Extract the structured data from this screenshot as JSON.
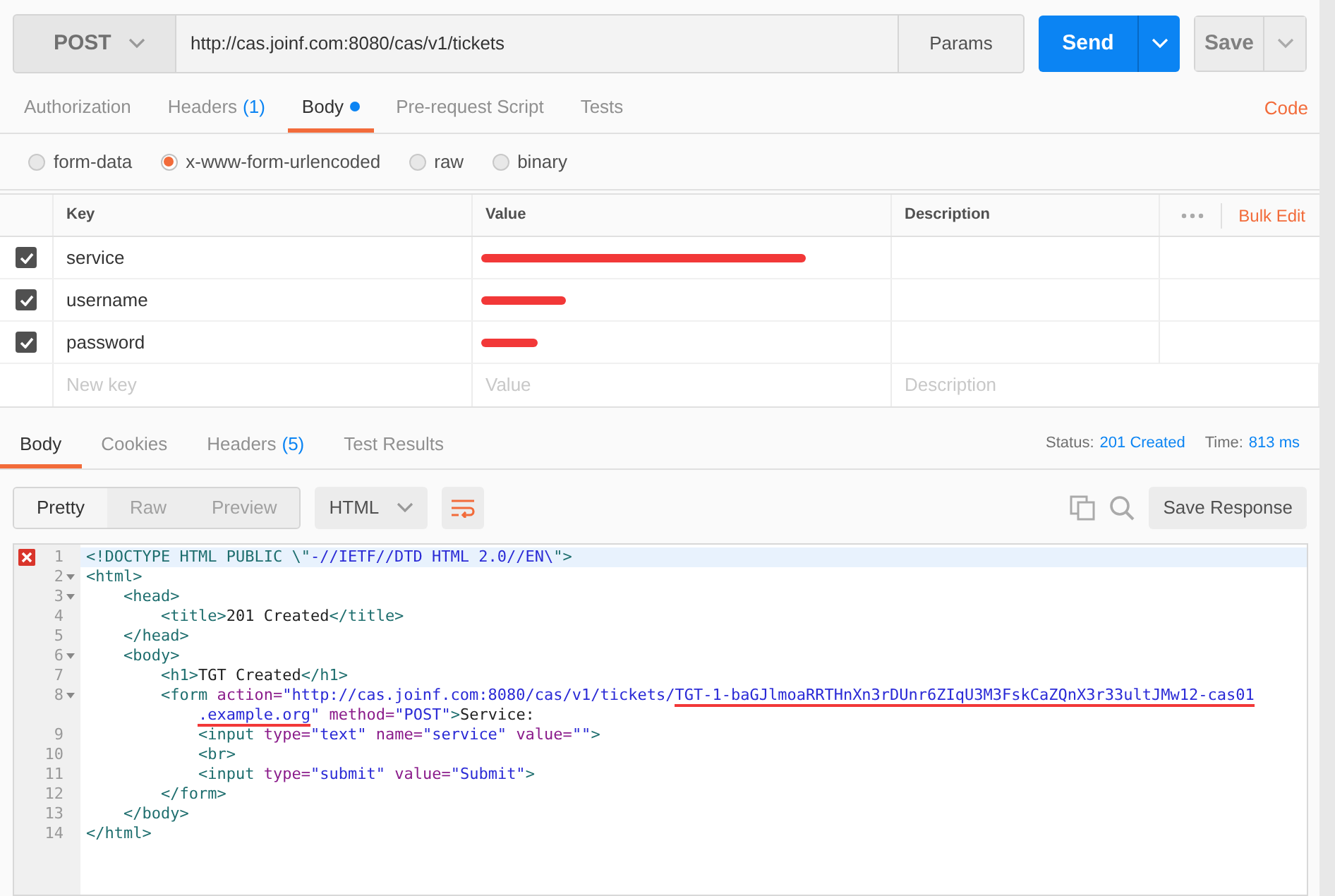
{
  "request": {
    "method": "POST",
    "url": "http://cas.joinf.com:8080/cas/v1/tickets",
    "params_label": "Params",
    "send_label": "Send",
    "save_label": "Save"
  },
  "request_tabs": [
    {
      "label": "Authorization",
      "selected": false
    },
    {
      "label": "Headers",
      "count": "(1)",
      "selected": false
    },
    {
      "label": "Body",
      "selected": true,
      "dot": true
    },
    {
      "label": "Pre-request Script",
      "selected": false
    },
    {
      "label": "Tests",
      "selected": false
    }
  ],
  "code_link": "Code",
  "body_types": [
    {
      "label": "form-data",
      "selected": false
    },
    {
      "label": "x-www-form-urlencoded",
      "selected": true
    },
    {
      "label": "raw",
      "selected": false
    },
    {
      "label": "binary",
      "selected": false
    }
  ],
  "params_table": {
    "columns": [
      "Key",
      "Value",
      "Description"
    ],
    "bulk_edit": "Bulk Edit",
    "rows": [
      {
        "key": "service",
        "checked": true,
        "value_redacted": true
      },
      {
        "key": "username",
        "checked": true,
        "value_redacted": true
      },
      {
        "key": "password",
        "checked": true,
        "value_redacted": true
      }
    ],
    "new_row": {
      "key_placeholder": "New key",
      "value_placeholder": "Value",
      "description_placeholder": "Description"
    }
  },
  "response_tabs": [
    {
      "label": "Body",
      "selected": true
    },
    {
      "label": "Cookies",
      "selected": false
    },
    {
      "label": "Headers",
      "count": "(5)",
      "selected": false
    },
    {
      "label": "Test Results",
      "selected": false
    }
  ],
  "status": {
    "label": "Status:",
    "value": "201 Created"
  },
  "time": {
    "label": "Time:",
    "value": "813 ms"
  },
  "view_modes": [
    {
      "label": "Pretty",
      "selected": true
    },
    {
      "label": "Raw",
      "selected": false
    },
    {
      "label": "Preview",
      "selected": false
    }
  ],
  "format": "HTML",
  "save_response": "Save Response",
  "code_lines": [
    {
      "number": "1",
      "error": true,
      "fold": false,
      "highlighted": true,
      "tokens": [
        {
          "kind": "tag",
          "text": "<!DOCTYPE HTML PUBLIC \\\""
        },
        {
          "kind": "string",
          "text": "-//IETF//DTD HTML 2.0//EN\\"
        },
        {
          "kind": "tag",
          "text": "\">"
        }
      ]
    },
    {
      "number": "2",
      "error": false,
      "fold": true,
      "tokens": [
        {
          "kind": "tag",
          "text": "<html>"
        }
      ]
    },
    {
      "number": "3",
      "error": false,
      "fold": true,
      "tokens": [
        {
          "kind": "tag",
          "text": "    <head>"
        }
      ]
    },
    {
      "number": "4",
      "error": false,
      "fold": false,
      "tokens": [
        {
          "kind": "tag",
          "text": "        <title>"
        },
        {
          "kind": "text",
          "text": "201 Created"
        },
        {
          "kind": "tag",
          "text": "</title>"
        }
      ]
    },
    {
      "number": "5",
      "error": false,
      "fold": false,
      "tokens": [
        {
          "kind": "tag",
          "text": "    </head>"
        }
      ]
    },
    {
      "number": "6",
      "error": false,
      "fold": true,
      "tokens": [
        {
          "kind": "tag",
          "text": "    <body>"
        }
      ]
    },
    {
      "number": "7",
      "error": false,
      "fold": false,
      "tokens": [
        {
          "kind": "tag",
          "text": "        <h1>"
        },
        {
          "kind": "text",
          "text": "TGT Created"
        },
        {
          "kind": "tag",
          "text": "</h1>"
        }
      ]
    },
    {
      "number": "8",
      "error": false,
      "fold": true,
      "tokens": [
        {
          "kind": "tag",
          "text": "        <form "
        },
        {
          "kind": "attr",
          "text": "action="
        },
        {
          "kind": "string",
          "text": "\"http://cas.joinf.com:8080/cas/v1/tickets/"
        },
        {
          "kind": "string",
          "text": "TGT-1-baGJlmoaRRTHnXn3rDUnr6ZIqU3M3FskCaZQnX3r33ultJMw12-cas01",
          "marked": true
        }
      ]
    },
    {
      "error": false,
      "fold": false,
      "tokens": [
        {
          "kind": "string",
          "text": "            .example.org",
          "marked": true
        },
        {
          "kind": "string",
          "text": "\" "
        },
        {
          "kind": "attr",
          "text": "method="
        },
        {
          "kind": "string",
          "text": "\"POST\""
        },
        {
          "kind": "tag",
          "text": ">"
        },
        {
          "kind": "text",
          "text": "Service:"
        }
      ]
    },
    {
      "number": "9",
      "error": false,
      "fold": false,
      "tokens": [
        {
          "kind": "tag",
          "text": "            <input "
        },
        {
          "kind": "attr",
          "text": "type="
        },
        {
          "kind": "string",
          "text": "\"text\" "
        },
        {
          "kind": "attr",
          "text": "name="
        },
        {
          "kind": "string",
          "text": "\"service\" "
        },
        {
          "kind": "attr",
          "text": "value="
        },
        {
          "kind": "string",
          "text": "\"\""
        },
        {
          "kind": "tag",
          "text": ">"
        }
      ]
    },
    {
      "number": "10",
      "error": false,
      "fold": false,
      "tokens": [
        {
          "kind": "tag",
          "text": "            <br>"
        }
      ]
    },
    {
      "number": "11",
      "error": false,
      "fold": false,
      "tokens": [
        {
          "kind": "tag",
          "text": "            <input "
        },
        {
          "kind": "attr",
          "text": "type="
        },
        {
          "kind": "string",
          "text": "\"submit\" "
        },
        {
          "kind": "attr",
          "text": "value="
        },
        {
          "kind": "string",
          "text": "\"Submit\""
        },
        {
          "kind": "tag",
          "text": ">"
        }
      ]
    },
    {
      "number": "12",
      "error": false,
      "fold": false,
      "tokens": [
        {
          "kind": "tag",
          "text": "        </form>"
        }
      ]
    },
    {
      "number": "13",
      "error": false,
      "fold": false,
      "tokens": [
        {
          "kind": "tag",
          "text": "    </body>"
        }
      ]
    },
    {
      "number": "14",
      "error": false,
      "fold": false,
      "tokens": [
        {
          "kind": "tag",
          "text": "</html>"
        }
      ]
    }
  ]
}
